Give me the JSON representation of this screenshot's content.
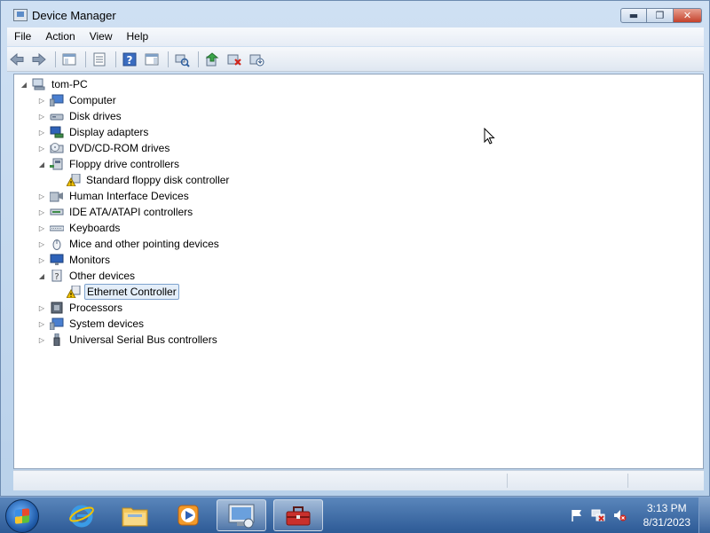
{
  "window": {
    "title": "Device Manager",
    "controls": {
      "minimize": "▬",
      "maximize": "❐",
      "close": "✕"
    }
  },
  "menubar": [
    "File",
    "Action",
    "View",
    "Help"
  ],
  "toolbar": {
    "buttons": [
      "back-icon",
      "forward-icon",
      "show-hide-console-tree-icon",
      "properties-icon",
      "help-icon",
      "action-pane-icon",
      "scan-hardware-icon",
      "update-driver-icon",
      "uninstall-icon",
      "disable-icon"
    ]
  },
  "tree": {
    "root": "tom-PC",
    "items": [
      {
        "label": "Computer",
        "expanded": false
      },
      {
        "label": "Disk drives",
        "expanded": false
      },
      {
        "label": "Display adapters",
        "expanded": false
      },
      {
        "label": "DVD/CD-ROM drives",
        "expanded": false
      },
      {
        "label": "Floppy drive controllers",
        "expanded": true,
        "children": [
          {
            "label": "Standard floppy disk controller",
            "warning": true
          }
        ]
      },
      {
        "label": "Human Interface Devices",
        "expanded": false
      },
      {
        "label": "IDE ATA/ATAPI controllers",
        "expanded": false
      },
      {
        "label": "Keyboards",
        "expanded": false
      },
      {
        "label": "Mice and other pointing devices",
        "expanded": false
      },
      {
        "label": "Monitors",
        "expanded": false
      },
      {
        "label": "Other devices",
        "expanded": true,
        "children": [
          {
            "label": "Ethernet Controller",
            "warning": true,
            "selected": true
          }
        ]
      },
      {
        "label": "Processors",
        "expanded": false
      },
      {
        "label": "System devices",
        "expanded": false
      },
      {
        "label": "Universal Serial Bus controllers",
        "expanded": false
      }
    ]
  },
  "taskbar": {
    "apps": [
      "internet-explorer-icon",
      "windows-explorer-icon",
      "media-player-icon",
      "device-manager-app-icon",
      "toolbox-app-icon"
    ],
    "clock": {
      "time": "3:13 PM",
      "date": "8/31/2023"
    }
  },
  "colors": {
    "accent": "#2d5a96",
    "selection": "#e4eef9",
    "warning": "#f2c200"
  }
}
